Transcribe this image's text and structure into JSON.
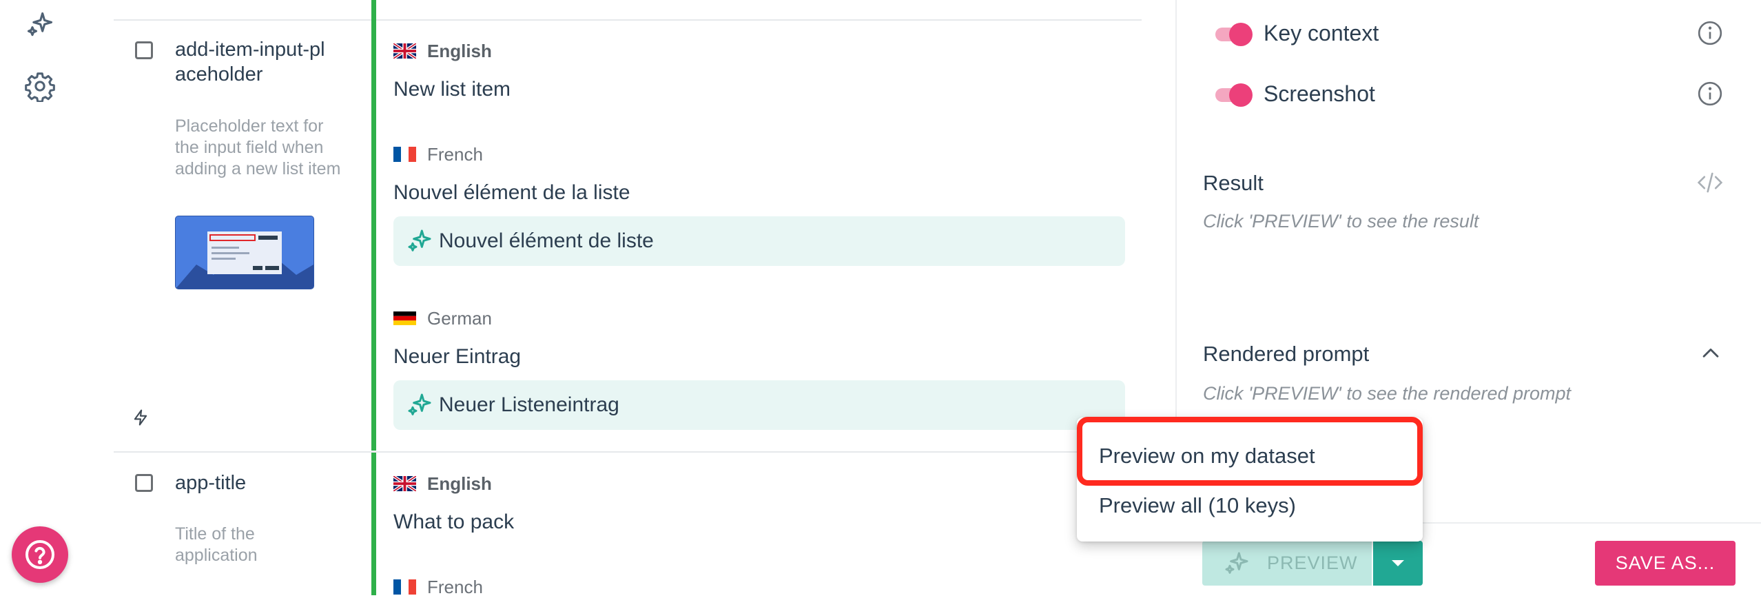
{
  "rail": {
    "icons": [
      "sparkle-icon",
      "gear-icon"
    ]
  },
  "keys": [
    {
      "name": "add-item-input-placeholder",
      "name_line1": "add-item-input-pl",
      "name_line2": "aceholder",
      "description": "Placeholder text for the input field when adding a new list item",
      "translations": [
        {
          "language": "English",
          "flag": "uk",
          "text": "New list item"
        },
        {
          "language": "French",
          "flag": "fr",
          "text": "Nouvel élément de la liste",
          "ai_suggestion": "Nouvel élément de liste"
        },
        {
          "language": "German",
          "flag": "de",
          "text": "Neuer Eintrag",
          "ai_suggestion": "Neuer Listeneintrag"
        }
      ]
    },
    {
      "name": "app-title",
      "description": "Title of the application",
      "translations": [
        {
          "language": "English",
          "flag": "uk",
          "text": "What to pack"
        },
        {
          "language": "French",
          "flag": "fr",
          "text": ""
        }
      ]
    }
  ],
  "panel": {
    "options": [
      {
        "label": "Key context",
        "enabled": true
      },
      {
        "label": "Screenshot",
        "enabled": true
      }
    ],
    "result": {
      "title": "Result",
      "hint": "Click 'PREVIEW' to see the result"
    },
    "rendered_prompt": {
      "title": "Rendered prompt",
      "hint": "Click 'PREVIEW' to see the rendered prompt"
    }
  },
  "menu": {
    "items": [
      "Preview on my dataset",
      "Preview all (10 keys)"
    ]
  },
  "buttons": {
    "preview": "PREVIEW",
    "save_as": "SAVE AS..."
  },
  "colors": {
    "accent_pink": "#e53877",
    "accent_teal": "#21a894",
    "ai_bg": "#e8f6f4",
    "highlight_red": "#ff2a1f",
    "green_bar": "#2fb04a"
  }
}
